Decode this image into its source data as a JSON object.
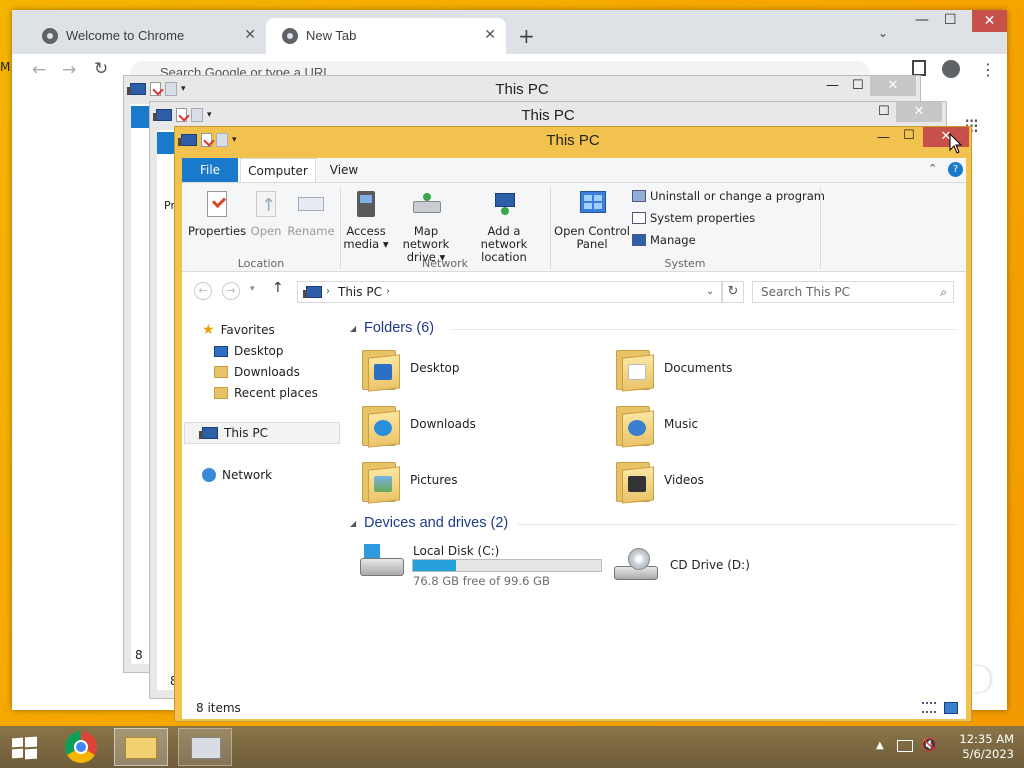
{
  "chrome": {
    "tabs": [
      {
        "label": "Welcome to Chrome",
        "close": "✕"
      },
      {
        "label": "New Tab",
        "close": "✕"
      }
    ],
    "new_tab": "+",
    "omnibox_placeholder": "Search Google or type a URL",
    "left_edge_letter": "M",
    "window_controls": {
      "minimize": "—",
      "maximize": "☐",
      "close": "✕"
    }
  },
  "back_windows": [
    {
      "title": "This PC",
      "close": "✕"
    },
    {
      "title": "This PC",
      "close": "✕"
    }
  ],
  "back_fragments": {
    "pr": "Pr",
    "eight_a": "8",
    "eight_b": "8"
  },
  "explorer": {
    "title": "This PC",
    "ribbon_tabs": [
      "File",
      "Computer",
      "View"
    ],
    "ribbon": {
      "location": {
        "label": "Location",
        "buttons": [
          {
            "label": "Properties",
            "disabled": false
          },
          {
            "label": "Open",
            "disabled": true
          },
          {
            "label": "Rename",
            "disabled": true
          }
        ]
      },
      "network": {
        "label": "Network",
        "buttons": [
          {
            "line1": "Access",
            "line2": "media ▾"
          },
          {
            "line1": "Map network",
            "line2": "drive ▾"
          },
          {
            "line1": "Add a network",
            "line2": "location"
          }
        ]
      },
      "system": {
        "label": "System",
        "open_control_panel": {
          "line1": "Open Control",
          "line2": "Panel"
        },
        "links": [
          "Uninstall or change a program",
          "System properties",
          "Manage"
        ]
      }
    },
    "address": {
      "path": "This PC",
      "search_placeholder": "Search This PC"
    },
    "nav": {
      "favorites": "Favorites",
      "favorite_items": [
        "Desktop",
        "Downloads",
        "Recent places"
      ],
      "this_pc": "This PC",
      "network": "Network"
    },
    "folders_header": "Folders (6)",
    "folders": [
      "Desktop",
      "Documents",
      "Downloads",
      "Music",
      "Pictures",
      "Videos"
    ],
    "devices_header": "Devices and drives (2)",
    "drives": [
      {
        "name": "Local Disk (C:)",
        "free": "76.8 GB free of 99.6 GB",
        "used_fraction": 0.23
      },
      {
        "name": "CD Drive (D:)"
      }
    ],
    "status": "8 items"
  },
  "taskbar": {
    "time": "12:35 AM",
    "date": "5/6/2023"
  },
  "colors": {
    "desktop": "#f5a800",
    "explorer_frame": "#f2c24f",
    "close_red": "#c7504a",
    "file_tab": "#1979ca",
    "progress": "#26a0da"
  }
}
